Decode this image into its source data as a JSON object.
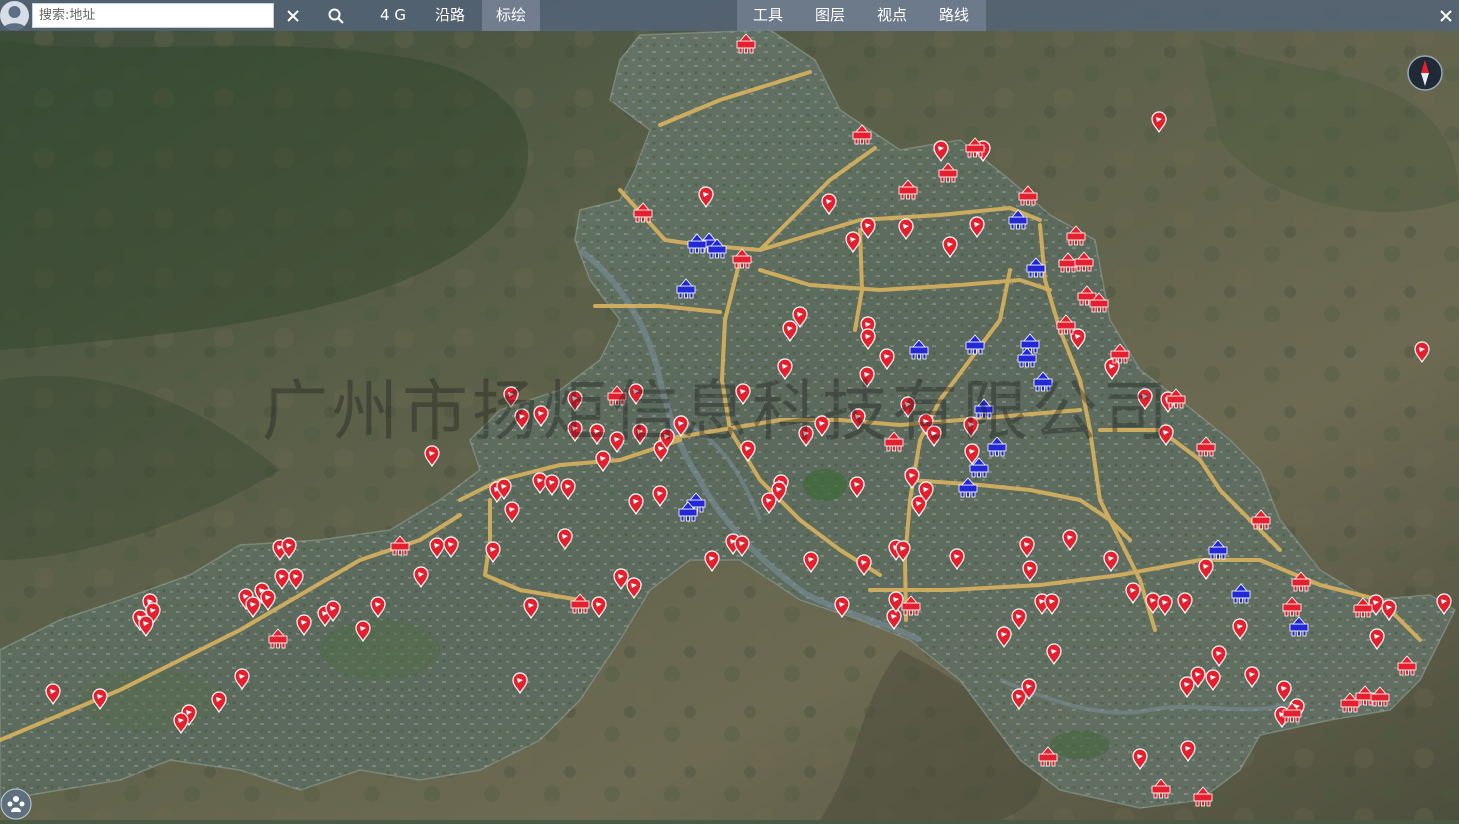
{
  "toolbar": {
    "search_placeholder": "搜索:地址",
    "items": [
      {
        "label": "4 G"
      },
      {
        "label": "沿路"
      },
      {
        "label": "标绘"
      }
    ],
    "menu": [
      {
        "label": "工具"
      },
      {
        "label": "图层"
      },
      {
        "label": "视点"
      },
      {
        "label": "路线"
      }
    ]
  },
  "watermark": "广州市扬炬信息科技有限公司",
  "icons": {
    "user": "user-avatar-icon",
    "clear": "close-icon",
    "search": "search-icon",
    "close_window": "close-icon",
    "compass": "compass-icon",
    "layers": "people-group-icon",
    "marker_red": "map-pin-icon",
    "marker_red_station": "station-icon",
    "marker_blue_station": "station-icon"
  },
  "colors": {
    "toolbar_bg": "#54647a",
    "marker_red": "#e5202e",
    "marker_blue": "#2228d6",
    "road": "#d9b25e",
    "boundary_land": "#5f6f5c"
  }
}
